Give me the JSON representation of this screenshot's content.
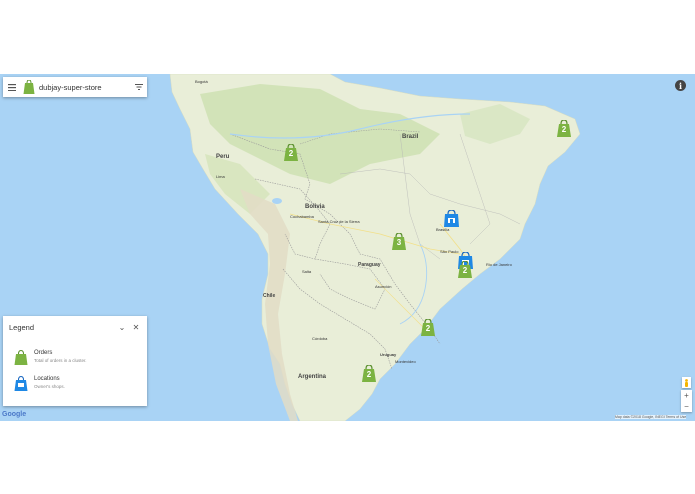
{
  "store": {
    "name": "dubjay-super-store"
  },
  "map": {
    "countries": [
      "Peru",
      "Brazil",
      "Bolivia",
      "Paraguay",
      "Chile",
      "Argentina",
      "Uruguay"
    ],
    "cities": [
      "Bogotá",
      "Lima",
      "Cochabamba",
      "Santa Cruz de la Sierra",
      "Brasília",
      "Rio de Janeiro",
      "São Paulo",
      "Córdoba",
      "Asunción",
      "Salta",
      "Montevideo"
    ]
  },
  "legend": {
    "title": "Legend",
    "items": [
      {
        "name": "Orders",
        "desc": "Total of orders in a cluster.",
        "icon": "shopping-bag-icon"
      },
      {
        "name": "Locations",
        "desc": "Owner's shops.",
        "icon": "shop-icon"
      }
    ]
  },
  "markers": [
    {
      "type": "orders",
      "count": "2"
    },
    {
      "type": "orders",
      "count": "2"
    },
    {
      "type": "orders",
      "count": "3"
    },
    {
      "type": "location",
      "count": ""
    },
    {
      "type": "location",
      "count": ""
    },
    {
      "type": "orders",
      "count": "2"
    },
    {
      "type": "orders",
      "count": "2"
    },
    {
      "type": "orders",
      "count": "2"
    }
  ],
  "controls": {
    "zoom_in": "+",
    "zoom_out": "−",
    "info": "i"
  },
  "footer": {
    "google": "Google",
    "attribution": "Map data ©2018 Google, INEGI   Terms of Use"
  },
  "colors": {
    "orders": "#7cb342",
    "location": "#1e88e5",
    "water": "#a9d3f5",
    "land": "#e9eed8"
  }
}
